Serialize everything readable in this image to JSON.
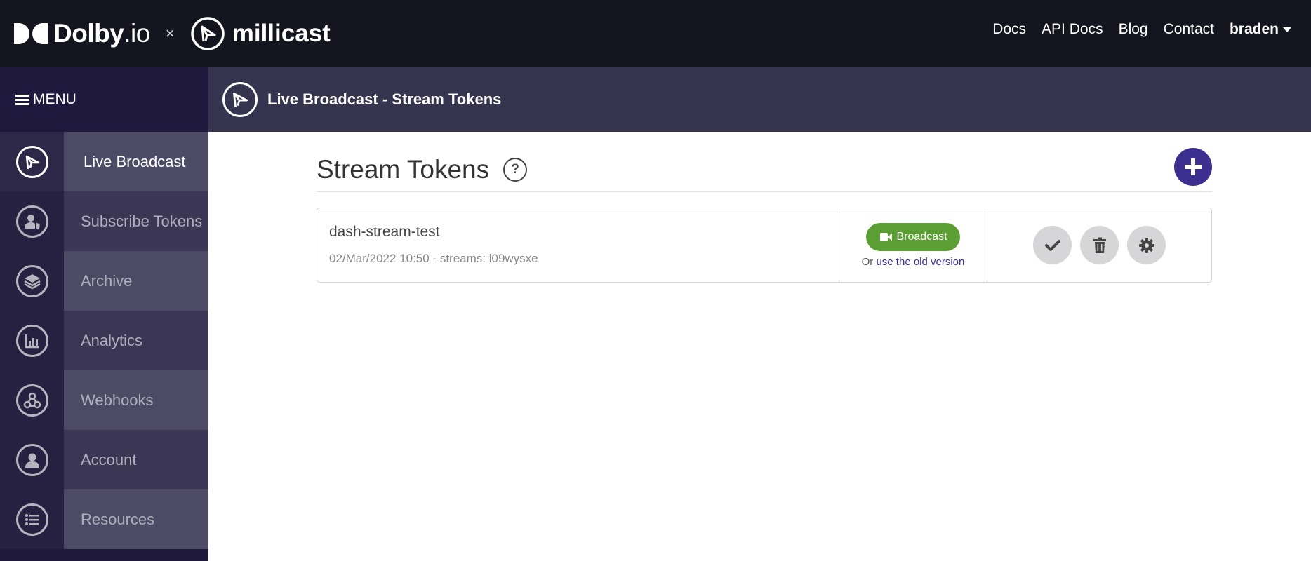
{
  "topbar": {
    "dolby": "Dolby",
    "dolby_io": ".io",
    "times": "×",
    "millicast": "millicast",
    "nav": [
      "Docs",
      "API Docs",
      "Blog",
      "Contact"
    ],
    "user": "braden"
  },
  "sidebar": {
    "menu_label": "MENU",
    "items": [
      {
        "label": "Live Broadcast",
        "icon": "millicast-icon"
      },
      {
        "label": "Subscribe Tokens",
        "icon": "user-shield-icon"
      },
      {
        "label": "Archive",
        "icon": "layers-icon"
      },
      {
        "label": "Analytics",
        "icon": "bar-chart-icon"
      },
      {
        "label": "Webhooks",
        "icon": "webhook-icon"
      },
      {
        "label": "Account",
        "icon": "user-icon"
      },
      {
        "label": "Resources",
        "icon": "list-icon"
      }
    ]
  },
  "page_header": {
    "title": "Live Broadcast - Stream Tokens"
  },
  "main": {
    "section_title": "Stream Tokens",
    "help": "?",
    "tokens": [
      {
        "name": "dash-stream-test",
        "meta": "02/Mar/2022 10:50 - streams: l09wysxe",
        "broadcast_label": "Broadcast",
        "or_text": "Or",
        "old_version_link": "use the old version"
      }
    ]
  },
  "colors": {
    "topbar_bg": "#15151f",
    "sidebar_bg": "#1f1a3d",
    "header_bg": "#37344f",
    "accent": "#3c2f8f",
    "broadcast_green": "#5b9e33"
  }
}
